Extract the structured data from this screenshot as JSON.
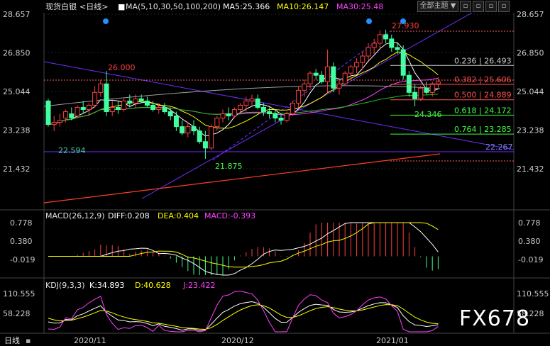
{
  "header": {
    "symbol": "现货白银",
    "period": "<日线>",
    "ma_label": "MA(5,10,30,50,100,200)",
    "ma5": "MA5:25.366",
    "ma10": "MA10:26.147",
    "ma30": "MA30:25.48",
    "theme_button": "全部主题",
    "colors": {
      "ma5": "#ffffff",
      "ma10": "#ffff00",
      "ma30": "#ff40ff"
    }
  },
  "macd_header": {
    "label": "MACD(26,12,9)",
    "diff": "DIFF:0.208",
    "dea": "DEA:0.404",
    "macd": "MACD:-0.393"
  },
  "kdj_header": {
    "label": "KDJ(9,3,3)",
    "k": "K:34.893",
    "d": "D:40.628",
    "j": "J:23.422"
  },
  "footer": {
    "period": "日线",
    "dates": [
      "2020/11",
      "2020/12",
      "2021/01"
    ]
  },
  "watermark": "FX678",
  "chart_data": [
    {
      "type": "candlestick",
      "price_ticks": [
        "28.657",
        "26.850",
        "25.044",
        "23.238",
        "21.432"
      ],
      "annotations": {
        "high_1": "26.000",
        "low_1": "22.594",
        "low_2": "21.875",
        "high_2": "27.930",
        "low_3": "24.346",
        "line_right": "22.267"
      },
      "fibonacci": [
        {
          "label": "0.236 | 26.493",
          "value": 26.493,
          "color": "#cccccc"
        },
        {
          "label": "0.382 | 25.606",
          "value": 25.606,
          "color": "#ff5050"
        },
        {
          "label": "0.500 | 24.889",
          "value": 24.889,
          "color": "#ff5050"
        },
        {
          "label": "0.618 | 24.172",
          "value": 24.172,
          "color": "#40ff40"
        },
        {
          "label": "0.764 | 23.285",
          "value": 23.285,
          "color": "#40ff40"
        }
      ],
      "candles": [
        [
          24.6,
          24.7,
          23.4,
          23.5
        ],
        [
          23.5,
          23.9,
          23.2,
          23.6
        ],
        [
          23.6,
          24.0,
          23.4,
          23.7
        ],
        [
          23.8,
          24.2,
          23.6,
          24.1
        ],
        [
          24.0,
          24.3,
          23.7,
          23.8
        ],
        [
          23.9,
          24.4,
          23.8,
          24.3
        ],
        [
          24.3,
          24.6,
          24.0,
          24.2
        ],
        [
          24.2,
          24.5,
          23.9,
          24.4
        ],
        [
          24.4,
          25.3,
          24.3,
          25.0
        ],
        [
          25.0,
          25.6,
          24.8,
          25.4
        ],
        [
          25.4,
          26.0,
          23.9,
          24.1
        ],
        [
          24.1,
          24.6,
          23.9,
          24.3
        ],
        [
          24.3,
          24.6,
          24.0,
          24.2
        ],
        [
          24.2,
          24.7,
          24.1,
          24.6
        ],
        [
          24.6,
          24.9,
          24.3,
          24.5
        ],
        [
          24.5,
          24.9,
          24.3,
          24.7
        ],
        [
          24.7,
          24.9,
          24.5,
          24.6
        ],
        [
          24.6,
          24.8,
          24.3,
          24.4
        ],
        [
          24.4,
          24.6,
          24.1,
          24.2
        ],
        [
          24.2,
          24.5,
          24.0,
          24.3
        ],
        [
          24.3,
          24.5,
          24.0,
          24.1
        ],
        [
          24.1,
          24.3,
          23.7,
          23.9
        ],
        [
          23.9,
          24.1,
          23.2,
          23.4
        ],
        [
          23.4,
          23.7,
          23.0,
          23.1
        ],
        [
          23.1,
          23.6,
          22.9,
          23.4
        ],
        [
          23.4,
          23.7,
          23.0,
          23.2
        ],
        [
          23.2,
          23.4,
          22.6,
          22.7
        ],
        [
          22.7,
          23.2,
          21.9,
          22.4
        ],
        [
          22.4,
          23.5,
          22.3,
          23.4
        ],
        [
          23.4,
          23.9,
          23.2,
          23.8
        ],
        [
          23.8,
          24.2,
          23.6,
          24.0
        ],
        [
          24.0,
          24.3,
          23.7,
          23.9
        ],
        [
          23.9,
          24.3,
          23.8,
          24.2
        ],
        [
          24.2,
          24.5,
          24.0,
          24.4
        ],
        [
          24.4,
          24.8,
          24.1,
          24.6
        ],
        [
          24.6,
          24.9,
          24.4,
          24.7
        ],
        [
          24.7,
          24.9,
          24.2,
          24.3
        ],
        [
          24.3,
          24.5,
          23.9,
          24.1
        ],
        [
          24.1,
          24.3,
          23.8,
          24.0
        ],
        [
          24.0,
          24.2,
          23.6,
          23.8
        ],
        [
          23.8,
          24.0,
          23.5,
          23.7
        ],
        [
          23.7,
          24.1,
          23.6,
          24.0
        ],
        [
          24.0,
          24.6,
          23.9,
          24.5
        ],
        [
          24.5,
          25.3,
          24.3,
          25.1
        ],
        [
          25.1,
          25.6,
          24.8,
          25.4
        ],
        [
          25.4,
          26.0,
          25.2,
          25.9
        ],
        [
          25.9,
          26.1,
          25.6,
          25.8
        ],
        [
          25.8,
          26.0,
          25.4,
          25.5
        ],
        [
          25.5,
          27.0,
          25.0,
          26.2
        ],
        [
          26.2,
          26.4,
          25.0,
          25.2
        ],
        [
          25.2,
          25.6,
          24.9,
          25.4
        ],
        [
          25.4,
          26.0,
          25.3,
          25.9
        ],
        [
          25.9,
          26.3,
          25.6,
          26.2
        ],
        [
          26.2,
          26.6,
          25.9,
          26.4
        ],
        [
          26.4,
          26.9,
          26.1,
          26.7
        ],
        [
          26.7,
          27.3,
          26.5,
          27.1
        ],
        [
          27.1,
          27.5,
          26.8,
          27.3
        ],
        [
          27.3,
          27.9,
          27.0,
          27.7
        ],
        [
          27.7,
          27.93,
          27.3,
          27.5
        ],
        [
          27.5,
          27.7,
          26.9,
          27.1
        ],
        [
          27.1,
          27.3,
          26.8,
          27.0
        ],
        [
          27.0,
          27.2,
          25.6,
          25.8
        ],
        [
          25.8,
          26.0,
          24.8,
          25.0
        ],
        [
          25.0,
          25.4,
          24.35,
          24.7
        ],
        [
          24.7,
          25.3,
          24.6,
          25.2
        ],
        [
          25.2,
          25.5,
          24.9,
          25.0
        ],
        [
          25.0,
          25.5,
          24.8,
          25.4
        ],
        [
          25.4,
          25.7,
          25.2,
          25.5
        ]
      ]
    },
    {
      "type": "macd",
      "ticks": [
        "0.778",
        "0.380",
        "-0.019"
      ],
      "diff": 0.208,
      "dea": 0.404,
      "macd": -0.393
    },
    {
      "type": "kdj",
      "ticks": [
        "110.555",
        "58.228"
      ],
      "k": 34.893,
      "d": 40.628,
      "j": 23.422
    }
  ]
}
